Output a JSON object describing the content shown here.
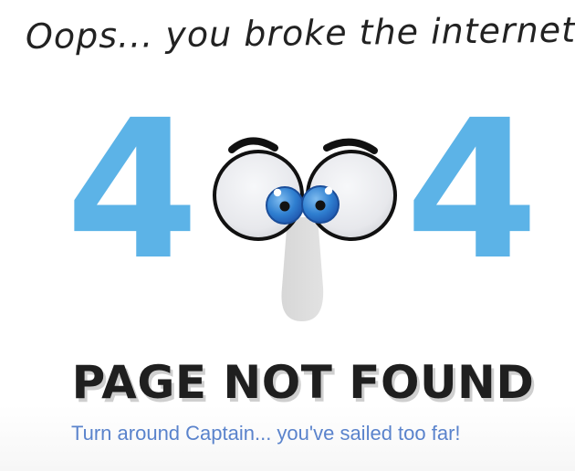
{
  "header": {
    "message": "Oops... you broke the internet!"
  },
  "illustration": {
    "left_digit": "4",
    "right_digit": "4",
    "colors": {
      "digit": "#5CB3E7",
      "outline": "#111111",
      "lens": "#E9EAEE",
      "iris": "#3179CB",
      "nose": "#D9D9D9"
    }
  },
  "content": {
    "title": "PAGE NOT FOUND",
    "subtitle": "Turn around Captain... you've sailed too far!"
  }
}
